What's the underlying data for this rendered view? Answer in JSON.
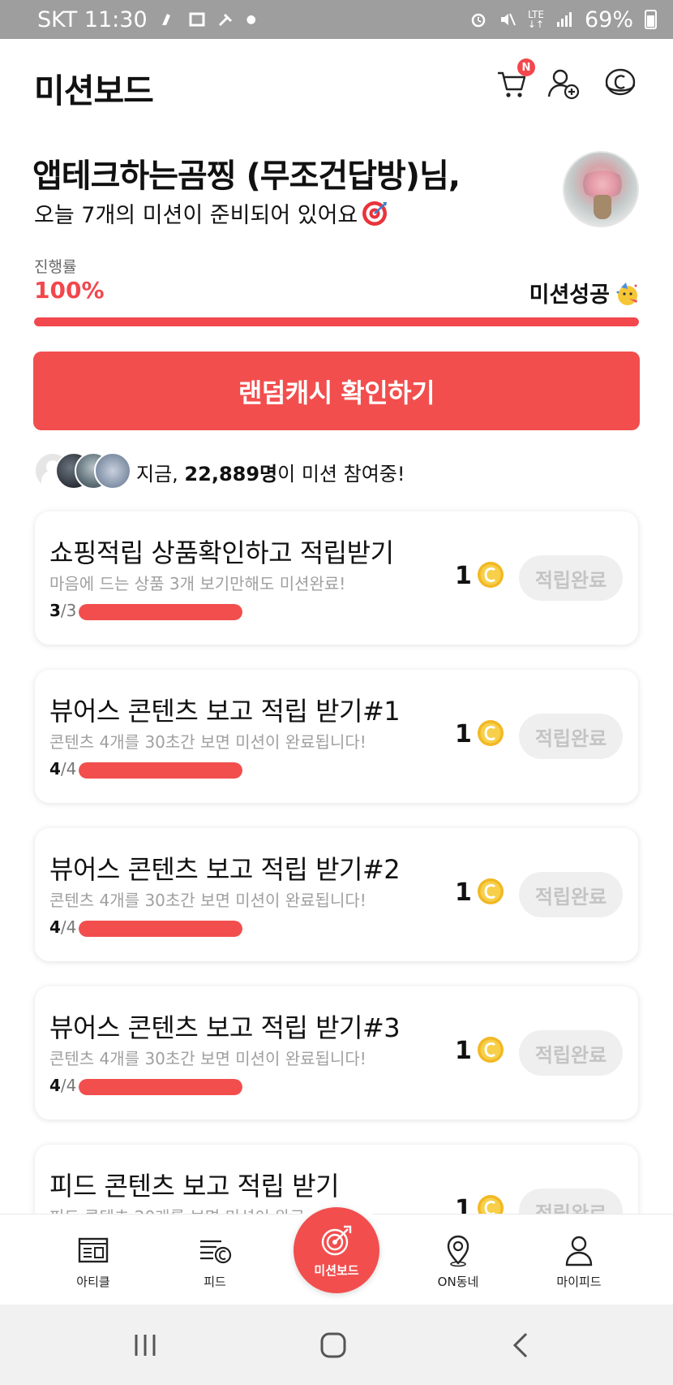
{
  "status_bar": {
    "carrier_time": "SKT 11:30",
    "network": "LTE",
    "battery": "69%"
  },
  "header": {
    "title": "미션보드",
    "cart_badge": "N"
  },
  "greeting": {
    "name_line": "앱테크하는곰찡 (무조건답방)님,",
    "sub_line": "오늘 7개의 미션이 준비되어 있어요"
  },
  "progress": {
    "label": "진행률",
    "value": "100%",
    "fraction": 1.0,
    "status": "미션성공"
  },
  "random_cash_button": "랜덤캐시 확인하기",
  "participants": {
    "prefix": "지금, ",
    "count": "22,889명",
    "suffix": "이 미션 참여중!"
  },
  "missions": [
    {
      "title": "쇼핑적립 상품확인하고 적립받기",
      "desc": "마음에 드는 상품 3개 보기만해도 미션완료!",
      "done": "3",
      "total": "3",
      "fraction": 1.0,
      "reward": "1",
      "button": "적립완료"
    },
    {
      "title": "뷰어스 콘텐츠 보고 적립 받기#1",
      "desc": "콘텐츠 4개를 30초간 보면 미션이 완료됩니다!",
      "done": "4",
      "total": "4",
      "fraction": 1.0,
      "reward": "1",
      "button": "적립완료"
    },
    {
      "title": "뷰어스 콘텐츠 보고 적립 받기#2",
      "desc": "콘텐츠 4개를 30초간 보면 미션이 완료됩니다!",
      "done": "4",
      "total": "4",
      "fraction": 1.0,
      "reward": "1",
      "button": "적립완료"
    },
    {
      "title": "뷰어스 콘텐츠 보고 적립 받기#3",
      "desc": "콘텐츠 4개를 30초간 보면 미션이 완료됩니다!",
      "done": "4",
      "total": "4",
      "fraction": 1.0,
      "reward": "1",
      "button": "적립완료"
    },
    {
      "title": "피드 콘텐츠 보고 적립 받기",
      "desc": "피드 콘텐츠 20개를 보면 미션이 완료됩니다!",
      "reward": "1",
      "button": "적립완료"
    }
  ],
  "bottom_nav": {
    "article": "아티클",
    "feed": "피드",
    "mission_board": "미션보드",
    "on_neighborhood": "ON동네",
    "my_feed": "마이피드"
  },
  "colors": {
    "accent": "#f24e4e",
    "coin": "#f2b824",
    "disabled_button": "#efefef"
  }
}
